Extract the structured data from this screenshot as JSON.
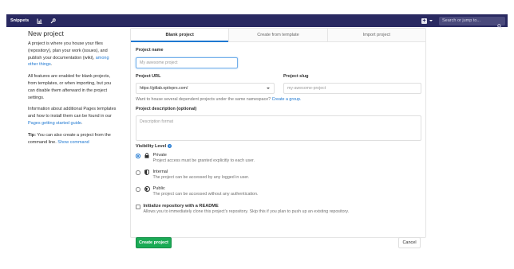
{
  "navbar": {
    "brand_label": "Snippets",
    "search_placeholder": "Search or jump to...",
    "icons": [
      "activity-chart-icon",
      "admin-wrench-icon",
      "plus-icon",
      "search-icon"
    ],
    "color": "#292961"
  },
  "sidebar": {
    "title": "New project",
    "p1_text": "A project is where you house your files (repository), plan your work (issues), and publish your documentation (wiki), ",
    "p1_link": "among other things",
    "p1_end": ".",
    "p2_text": "All features are enabled for blank projects, from templates, or when importing, but you can disable them afterward in the project settings.",
    "p3_text": "Information about additional Pages templates and how to install them can be found in our ",
    "p3_link": "Pages getting started guide",
    "p3_end": ".",
    "tip_bold": "Tip:",
    "tip_text": " You can also create a project from the command line. ",
    "tip_link": "Show command"
  },
  "tabs": [
    {
      "label": "Blank project",
      "active": true
    },
    {
      "label": "Create from template",
      "active": false
    },
    {
      "label": "Import project",
      "active": false
    }
  ],
  "form": {
    "project_name_label": "Project name",
    "project_name_placeholder": "My awesome project",
    "project_url_label": "Project URL",
    "project_url_value": "https://gitlab.optivprs.com/",
    "project_slug_label": "Project slug",
    "project_slug_placeholder": "my-awesome-project",
    "group_help_text": "Want to house several dependent projects under the same namespace? ",
    "group_help_link": "Create a group.",
    "description_label": "Project description (optional)",
    "description_placeholder": "Description format",
    "visibility_label": "Visibility Level",
    "visibility_options": [
      {
        "title": "Private",
        "desc": "Project access must be granted explicitly to each user.",
        "icon": "lock-icon",
        "checked": true
      },
      {
        "title": "Internal",
        "desc": "The project can be accessed by any logged in user.",
        "icon": "shield-icon",
        "checked": false
      },
      {
        "title": "Public",
        "desc": "The project can be accessed without any authentication.",
        "icon": "globe-icon",
        "checked": false
      }
    ],
    "readme_title": "Initialize repository with a README",
    "readme_desc": "Allows you to immediately clone this project's repository. Skip this if you plan to push up an existing repository.",
    "create_button": "Create project",
    "cancel_button": "Cancel"
  },
  "colors": {
    "accent": "#1f78d1",
    "success": "#1aaa55"
  }
}
